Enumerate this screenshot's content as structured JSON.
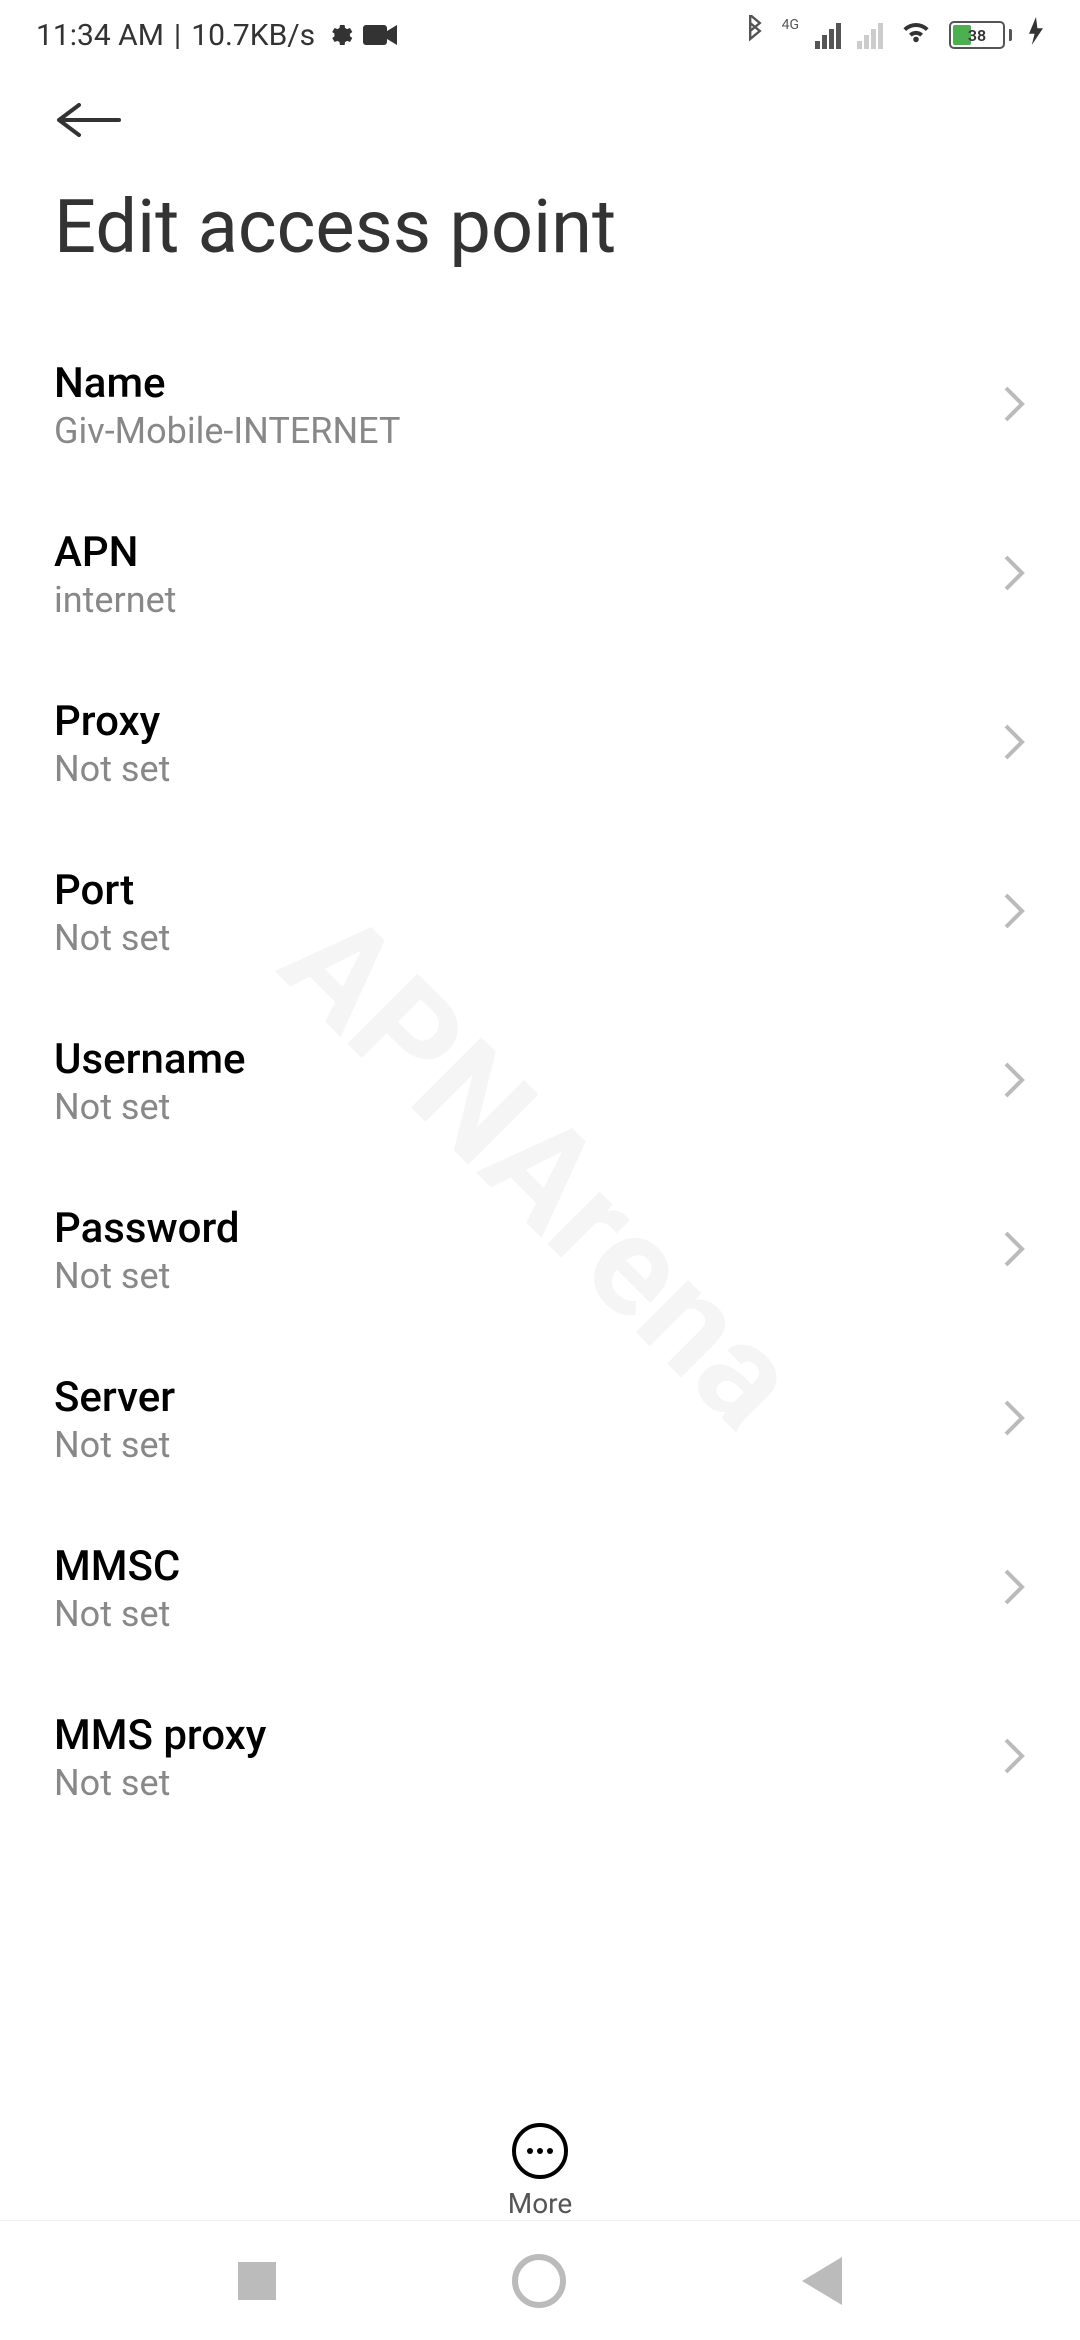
{
  "statusBar": {
    "time": "11:34 AM",
    "separator": "|",
    "netSpeed": "10.7KB/s",
    "netType": "4G",
    "batteryPercent": "38"
  },
  "page": {
    "title": "Edit access point"
  },
  "settings": [
    {
      "label": "Name",
      "value": "Giv-Mobile-INTERNET"
    },
    {
      "label": "APN",
      "value": "internet"
    },
    {
      "label": "Proxy",
      "value": "Not set"
    },
    {
      "label": "Port",
      "value": "Not set"
    },
    {
      "label": "Username",
      "value": "Not set"
    },
    {
      "label": "Password",
      "value": "Not set"
    },
    {
      "label": "Server",
      "value": "Not set"
    },
    {
      "label": "MMSC",
      "value": "Not set"
    },
    {
      "label": "MMS proxy",
      "value": "Not set"
    }
  ],
  "bottomBar": {
    "moreLabel": "More"
  },
  "watermark": "APNArena"
}
